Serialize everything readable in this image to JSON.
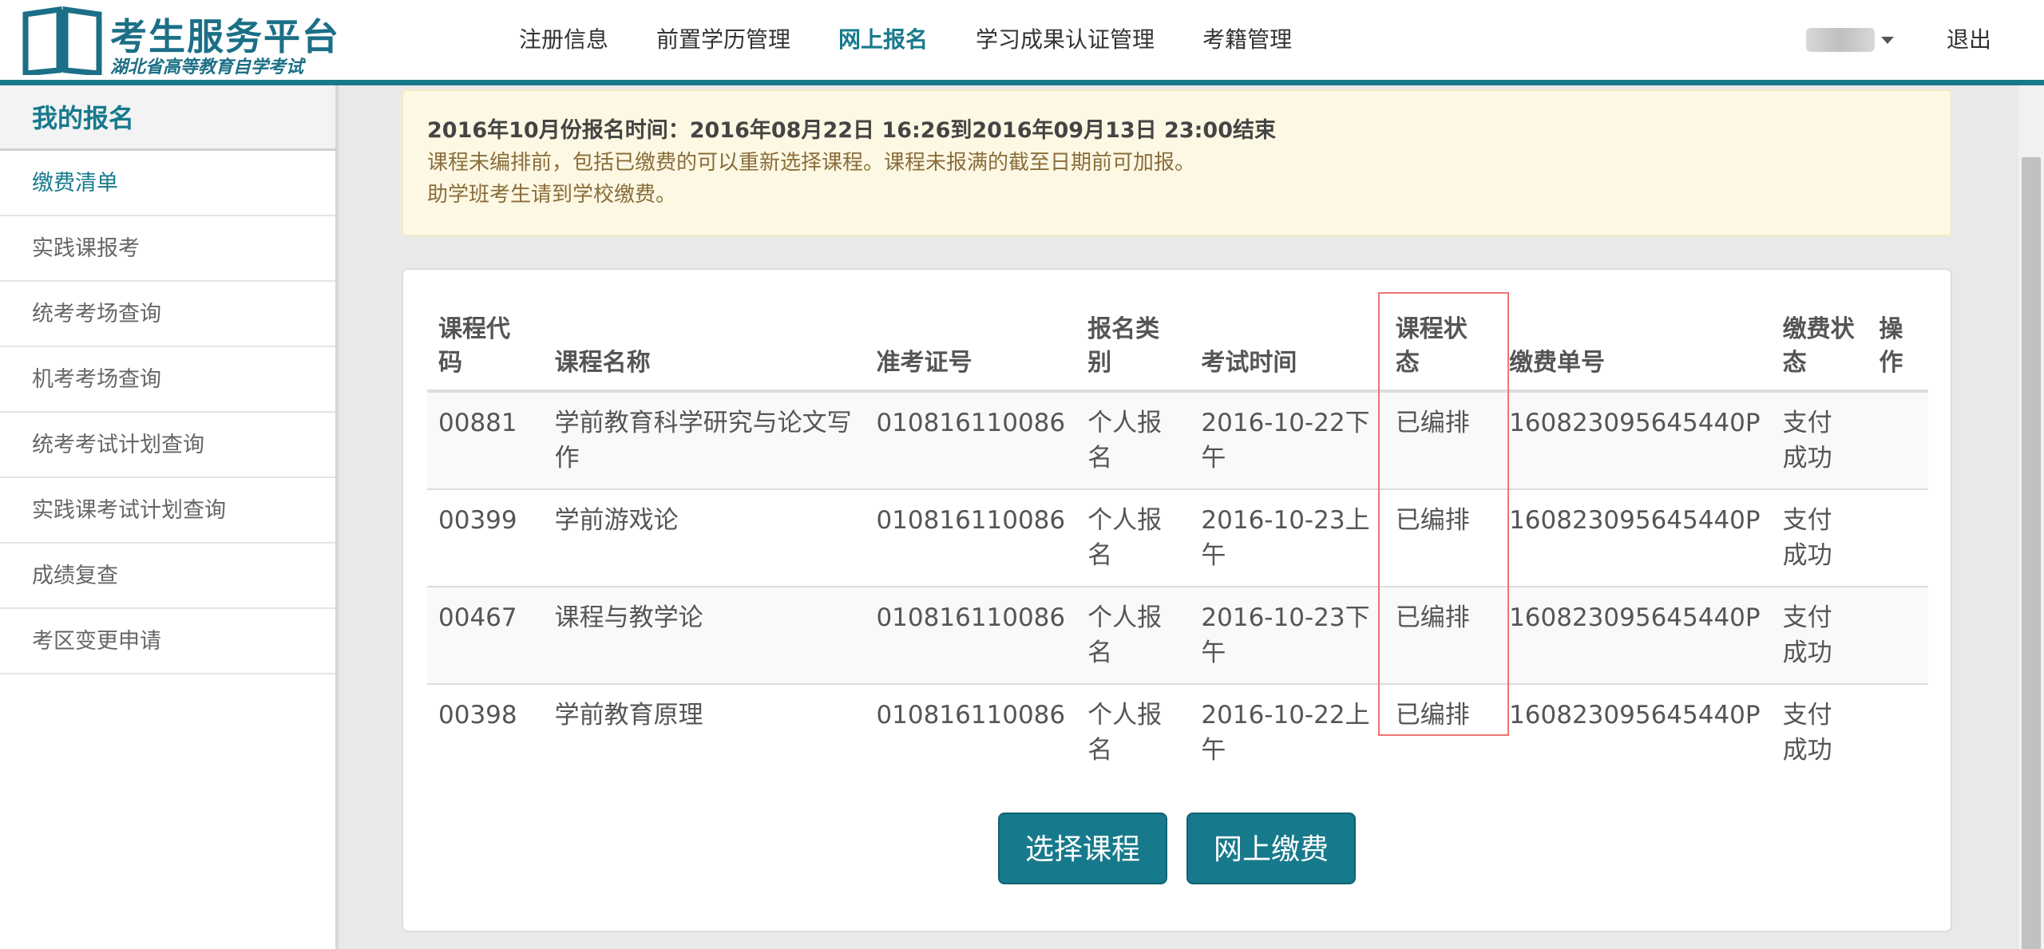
{
  "header": {
    "logo_title": "考生服务平台",
    "logo_subtitle": "湖北省高等教育自学考试",
    "nav": [
      {
        "label": "注册信息",
        "active": false
      },
      {
        "label": "前置学历管理",
        "active": false
      },
      {
        "label": "网上报名",
        "active": true
      },
      {
        "label": "学习成果认证管理",
        "active": false
      },
      {
        "label": "考籍管理",
        "active": false
      }
    ],
    "logout_label": "退出"
  },
  "sidebar": {
    "heading": "我的报名",
    "items": [
      {
        "label": "缴费清单",
        "active": true
      },
      {
        "label": "实践课报考",
        "active": false
      },
      {
        "label": "统考考场查询",
        "active": false
      },
      {
        "label": "机考考场查询",
        "active": false
      },
      {
        "label": "统考考试计划查询",
        "active": false
      },
      {
        "label": "实践课考试计划查询",
        "active": false
      },
      {
        "label": "成绩复查",
        "active": false
      },
      {
        "label": "考区变更申请",
        "active": false
      }
    ]
  },
  "notice": {
    "title": "2016年10月份报名时间：2016年08月22日 16:26到2016年09月13日 23:00结束",
    "line1": "课程未编排前，包括已缴费的可以重新选择课程。课程未报满的截至日期前可加报。",
    "line2": "助学班考生请到学校缴费。"
  },
  "table": {
    "headers": [
      "课程代码",
      "课程名称",
      "准考证号",
      "报名类别",
      "考试时间",
      "课程状态",
      "缴费单号",
      "缴费状态",
      "操作"
    ],
    "rows": [
      [
        "00881",
        "学前教育科学研究与论文写作",
        "010816110086",
        "个人报名",
        "2016-10-22下午",
        "已编排",
        "160823095645440P",
        "支付成功",
        ""
      ],
      [
        "00399",
        "学前游戏论",
        "010816110086",
        "个人报名",
        "2016-10-23上午",
        "已编排",
        "160823095645440P",
        "支付成功",
        ""
      ],
      [
        "00467",
        "课程与教学论",
        "010816110086",
        "个人报名",
        "2016-10-23下午",
        "已编排",
        "160823095645440P",
        "支付成功",
        ""
      ],
      [
        "00398",
        "学前教育原理",
        "010816110086",
        "个人报名",
        "2016-10-22上午",
        "已编排",
        "160823095645440P",
        "支付成功",
        ""
      ]
    ]
  },
  "buttons": {
    "select_course": "选择课程",
    "online_pay": "网上缴费"
  },
  "colors": {
    "brand": "#177a8c",
    "notice_bg": "#fcf8e3",
    "notice_text": "#8a6d3b",
    "highlight": "#f07373"
  }
}
